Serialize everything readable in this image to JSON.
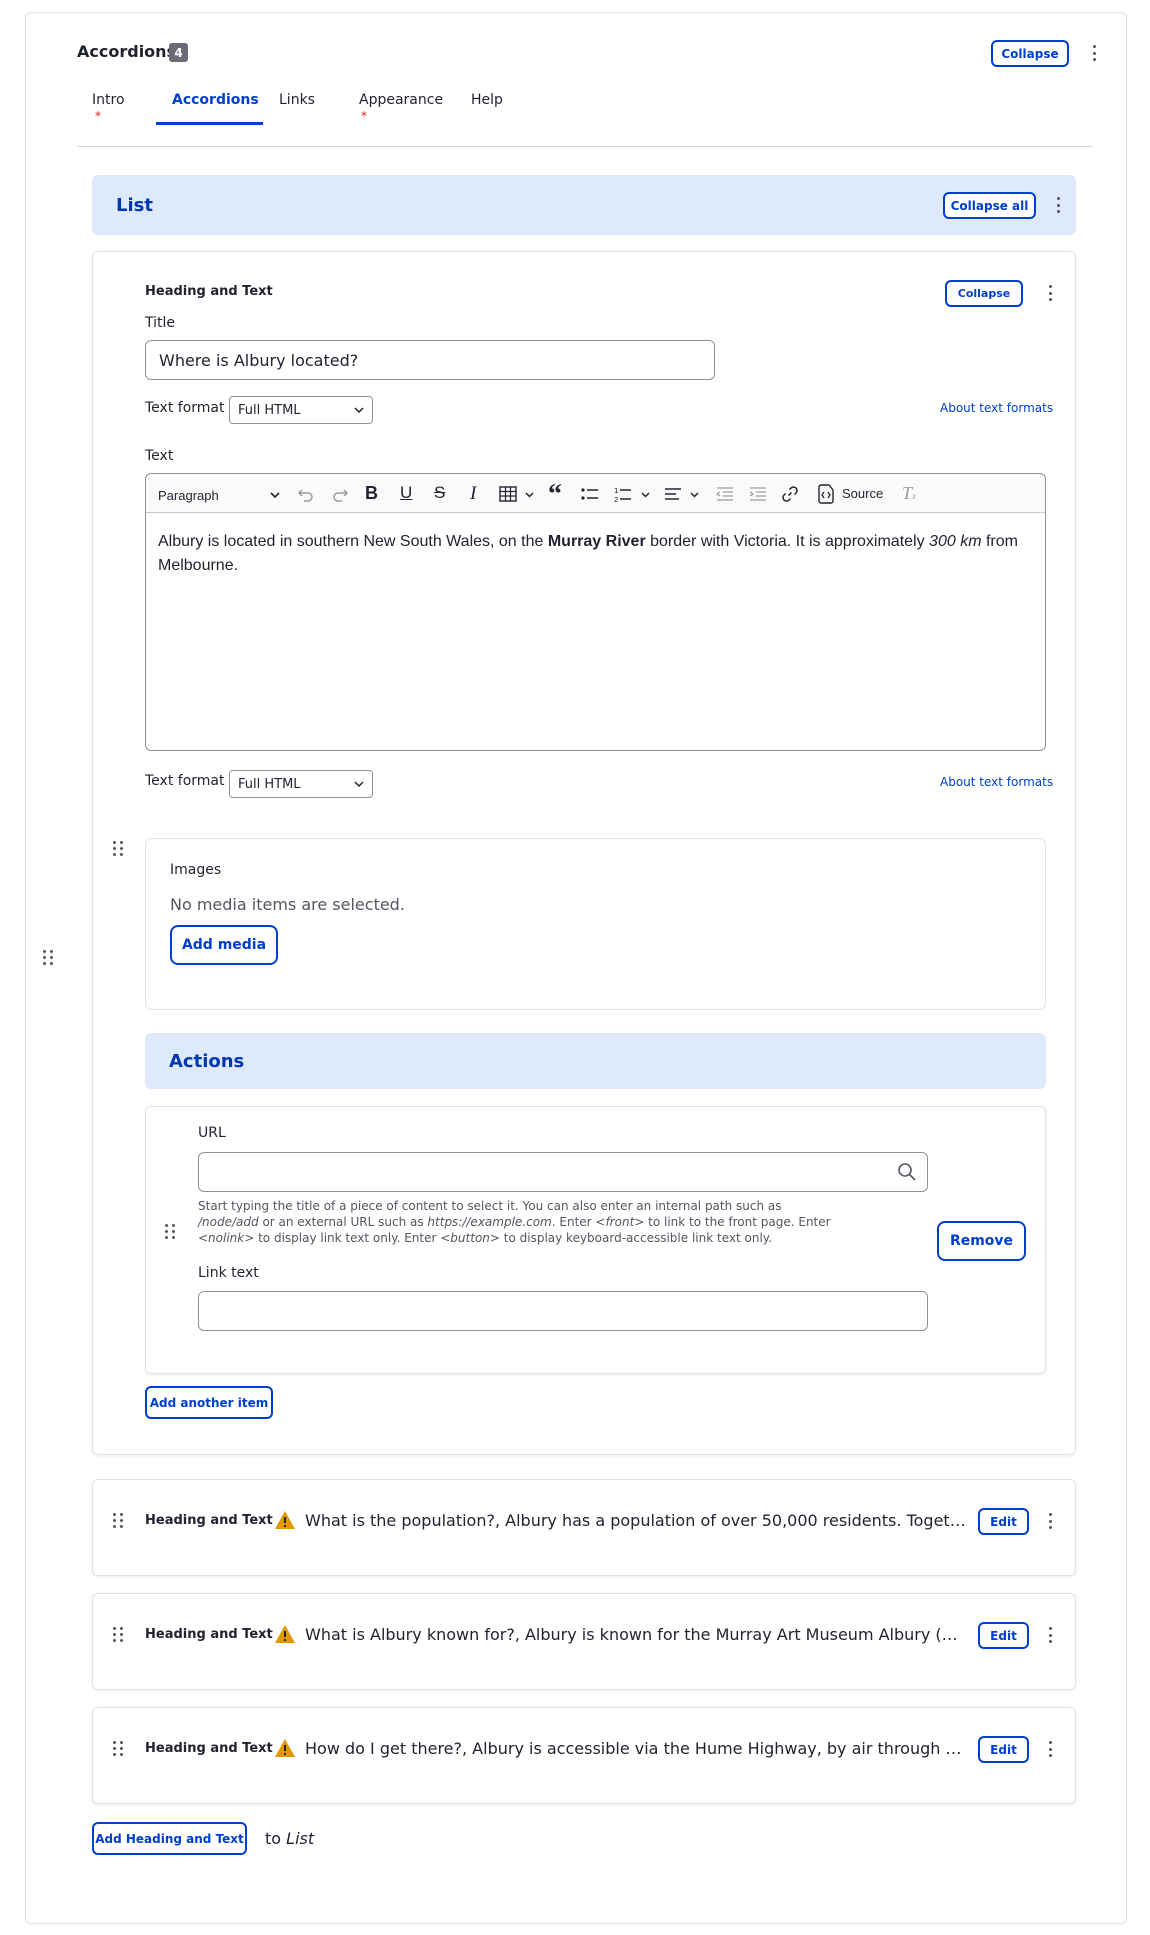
{
  "header": {
    "title": "Accordions",
    "count": "4",
    "collapse_label": "Collapse"
  },
  "tabs": [
    {
      "label": "Intro",
      "required": true
    },
    {
      "label": "Accordions",
      "active": true
    },
    {
      "label": "Links"
    },
    {
      "label": "Appearance",
      "required": true
    },
    {
      "label": "Help"
    }
  ],
  "list": {
    "title": "List",
    "collapse_all_label": "Collapse all"
  },
  "item1": {
    "type": "Heading and Text",
    "collapse_label": "Collapse",
    "title_label": "Title",
    "title_value": "Where is Albury located?",
    "text_format_label": "Text format",
    "text_format_value": "Full HTML",
    "about_formats": "About text formats",
    "text_label": "Text",
    "toolbar": {
      "paragraph": "Paragraph",
      "source": "Source"
    },
    "body": {
      "part1": "Albury is located in southern New South Wales, on the ",
      "bold": "Murray River",
      "part2": " border with Victoria. It is approximately ",
      "italic": "300 km",
      "part3": " from",
      "line2": "Melbourne."
    },
    "text_format2_label": "Text format",
    "text_format2_value": "Full HTML",
    "about_formats2": "About text formats",
    "images": {
      "label": "Images",
      "empty": "No media items are selected.",
      "add_label": "Add media"
    },
    "actions": {
      "title": "Actions",
      "url_label": "URL",
      "url_value": "",
      "desc_1": "Start typing the title of a piece of content to select it. You can also enter an internal path such as",
      "desc_2a": "/node/add",
      "desc_2b": " or an external URL such as ",
      "desc_2c": "https://example.com",
      "desc_2d": ". Enter ",
      "desc_2e": "<front>",
      "desc_2f": " to link to the front page. Enter",
      "desc_3a": "<nolink>",
      "desc_3b": " to display link text only. Enter ",
      "desc_3c": "<button>",
      "desc_3d": " to display keyboard-accessible link text only.",
      "link_text_label": "Link text",
      "link_text_value": "",
      "remove_label": "Remove",
      "add_another_label": "Add another item"
    }
  },
  "collapsed_items": [
    {
      "type": "Heading and Text",
      "summary": "What is the population?, Albury has a population of over 50,000 residents. Together wi...",
      "edit_label": "Edit"
    },
    {
      "type": "Heading and Text",
      "summary": "What is Albury known for?, Albury is known for the Murray Art Museum Albury (MAMA...",
      "edit_label": "Edit"
    },
    {
      "type": "Heading and Text",
      "summary": "How do I get there?, Albury is accessible via the Hume Highway, by air through Albury ...",
      "edit_label": "Edit"
    }
  ],
  "footer": {
    "add_label": "Add Heading and Text",
    "to": "to",
    "target": "List"
  },
  "colors": {
    "accent": "#003ecc",
    "banner_bg": "#dee9fc",
    "warning": "#e29700",
    "required": "#dc2323"
  }
}
